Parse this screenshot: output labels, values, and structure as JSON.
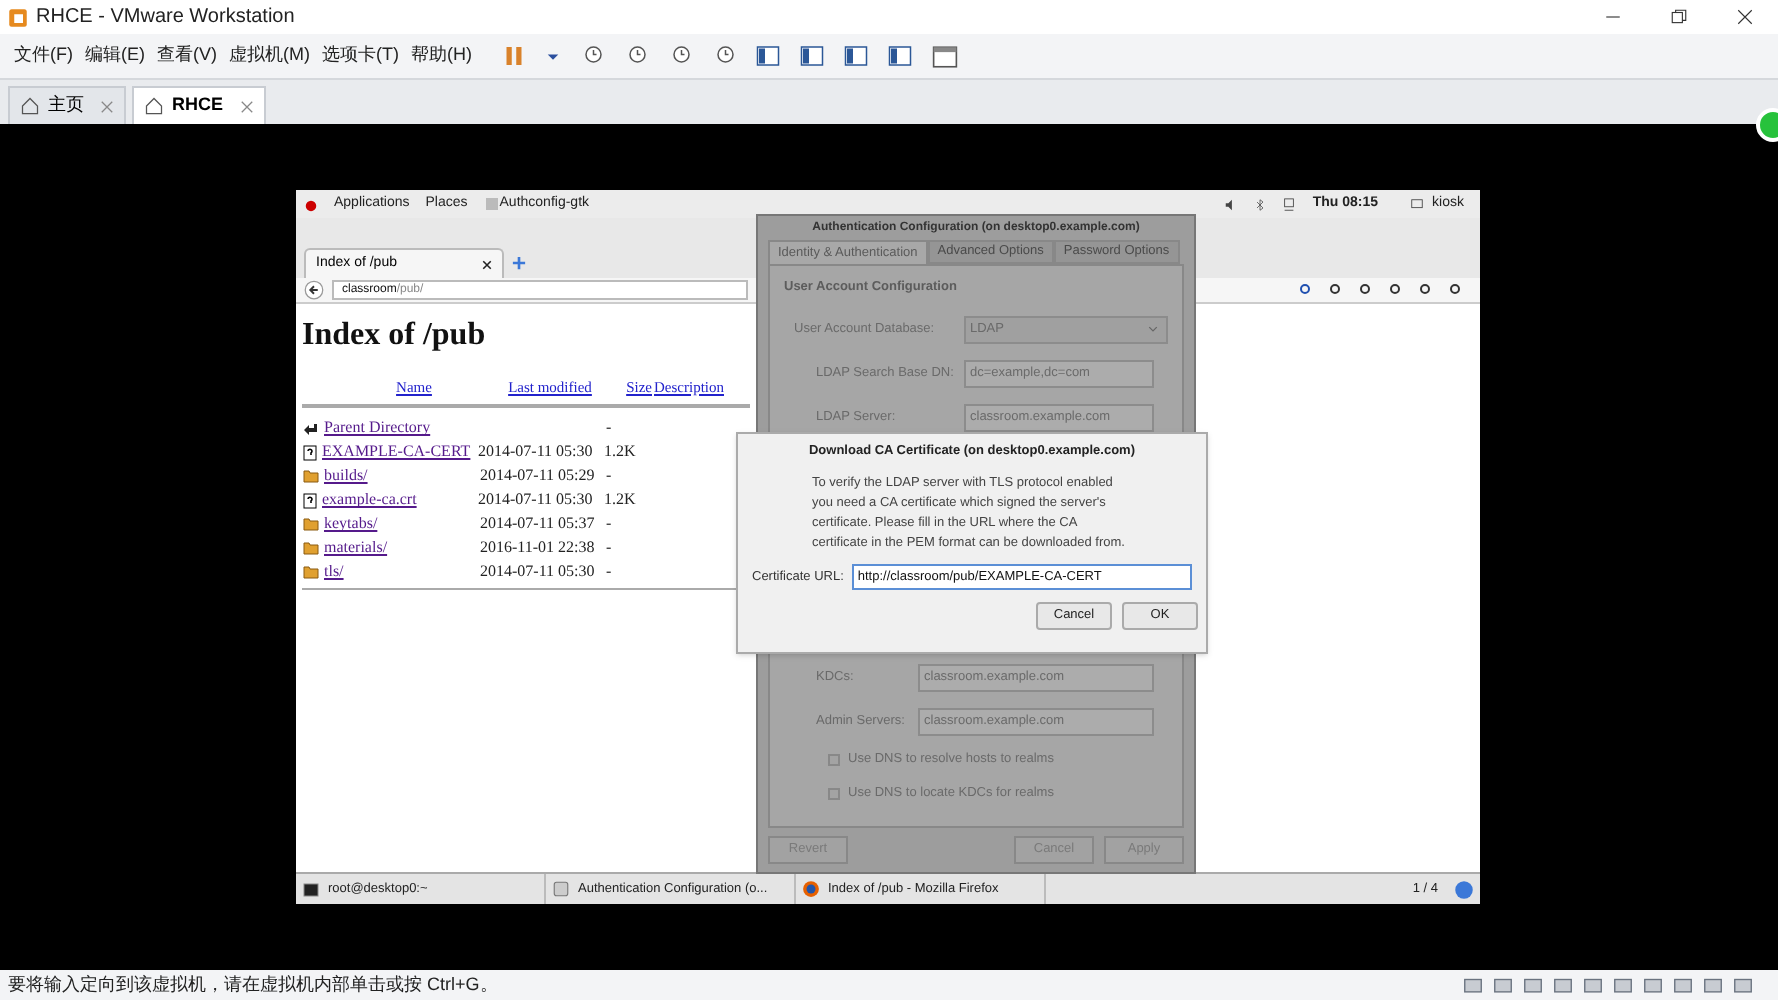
{
  "window": {
    "title": "RHCE - VMware Workstation"
  },
  "menu": [
    "文件(F)",
    "编辑(E)",
    "查看(V)",
    "虚拟机(M)",
    "选项卡(T)",
    "帮助(H)"
  ],
  "vm_tabs": [
    {
      "label": "主页",
      "selected": false
    },
    {
      "label": "RHCE",
      "selected": true
    }
  ],
  "guest": {
    "top_bar": {
      "menus": [
        "Applications",
        "Places"
      ],
      "app": "Authconfig-gtk",
      "clock": "Thu 08:15",
      "user": "kiosk"
    },
    "browser": {
      "tab": "Index of /pub",
      "url_host": "classroom",
      "url_path": "/pub/",
      "heading": "Index of /pub",
      "columns": [
        "Name",
        "Last modified",
        "Size",
        "Description"
      ],
      "rows": [
        {
          "kind": "parent",
          "name": "Parent Directory",
          "modified": "",
          "size": "-"
        },
        {
          "kind": "file",
          "name": "EXAMPLE-CA-CERT",
          "modified": "2014-07-11 05:30",
          "size": "1.2K"
        },
        {
          "kind": "folder",
          "name": "builds/",
          "modified": "2014-07-11 05:29",
          "size": "-"
        },
        {
          "kind": "file",
          "name": "example-ca.crt",
          "modified": "2014-07-11 05:30",
          "size": "1.2K"
        },
        {
          "kind": "folder",
          "name": "keytabs/",
          "modified": "2014-07-11 05:37",
          "size": "-"
        },
        {
          "kind": "folder",
          "name": "materials/",
          "modified": "2016-11-01 22:38",
          "size": "-"
        },
        {
          "kind": "folder",
          "name": "tls/",
          "modified": "2014-07-11 05:30",
          "size": "-"
        }
      ]
    },
    "auth_dialog": {
      "title": "Authentication Configuration (on desktop0.example.com)",
      "tabs": [
        {
          "label": "Identity & Authentication",
          "selected": true
        },
        {
          "label": "Advanced Options",
          "selected": false
        },
        {
          "label": "Password Options",
          "selected": false
        }
      ],
      "section": "User Account Configuration",
      "fields_top": [
        {
          "kind": "select",
          "label": "User Account Database:",
          "value": "LDAP"
        },
        {
          "kind": "text",
          "label": "LDAP Search Base DN:",
          "value": "dc=example,dc=com"
        },
        {
          "kind": "text",
          "label": "LDAP Server:",
          "value": "classroom.example.com"
        }
      ],
      "fields_bottom": [
        {
          "label": "KDCs:",
          "value": "classroom.example.com"
        },
        {
          "label": "Admin Servers:",
          "value": "classroom.example.com"
        }
      ],
      "checkboxes": [
        {
          "label": "Use DNS to resolve hosts to realms",
          "checked": false
        },
        {
          "label": "Use DNS to locate KDCs for realms",
          "checked": false
        }
      ],
      "buttons": [
        "Revert",
        "Cancel",
        "Apply"
      ]
    },
    "ca_dialog": {
      "title": "Download CA Certificate (on desktop0.example.com)",
      "message": "To verify the LDAP server with TLS protocol enabled you need a CA certificate which signed the server's certificate. Please fill in the URL where the CA certificate in the PEM format can be downloaded from.",
      "url_label": "Certificate URL:",
      "url_value": "http://classroom/pub/EXAMPLE-CA-CERT",
      "buttons": [
        "Cancel",
        "OK"
      ]
    },
    "taskbar": [
      {
        "kind": "terminal",
        "label": "root@desktop0:~"
      },
      {
        "kind": "app",
        "label": "Authentication Configuration (o..."
      },
      {
        "kind": "browser",
        "label": "Index of /pub - Mozilla Firefox"
      }
    ],
    "workspace": "1 / 4"
  },
  "status_bar": {
    "message": "要将输入定向到该虚拟机，请在虚拟机内部单击或按 Ctrl+G。"
  }
}
